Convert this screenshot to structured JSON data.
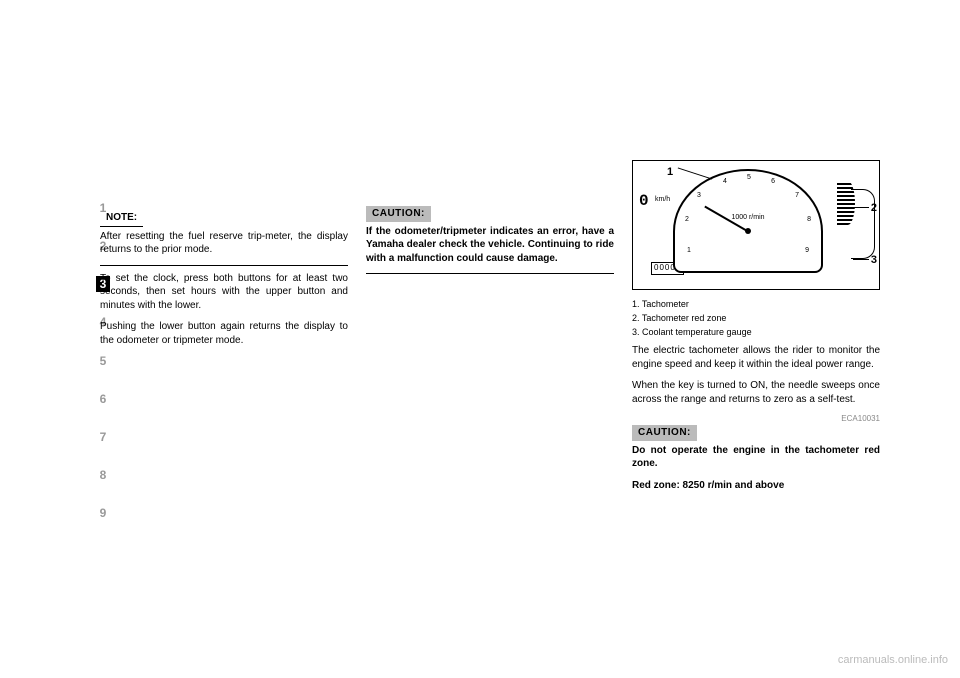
{
  "sidebar": {
    "nums": [
      "1",
      "2",
      "3",
      "4",
      "5",
      "6",
      "7",
      "8",
      "9"
    ],
    "active_index": 2
  },
  "col1": {
    "note_label": "NOTE:",
    "note_text": "After resetting the fuel reserve trip-meter, the display returns to the prior mode.",
    "para2": "To set the clock, press both buttons for at least two seconds, then set hours with the upper button and minutes with the lower.",
    "para3": "Pushing the lower button again returns the display to the odometer or tripmeter mode."
  },
  "col2": {
    "caution_label": "CAUTION:",
    "caution_text": "If the odometer/tripmeter indicates an error, have a Yamaha dealer check the vehicle. Continuing to ride with a malfunction could cause damage."
  },
  "col3": {
    "figure": {
      "dial_unit": "1000 r/min",
      "callout1": "1",
      "callout2": "2",
      "callout3": "3",
      "km_label": "km/h",
      "odometer": "00000",
      "speed": "0",
      "ticks": [
        "1",
        "2",
        "3",
        "4",
        "5",
        "6",
        "7",
        "8",
        "9"
      ]
    },
    "legend": {
      "i1": "1. Tachometer",
      "i2": "2. Tachometer red zone",
      "i3": "3. Coolant temperature gauge"
    },
    "para1": "The electric tachometer allows the rider to monitor the engine speed and keep it within the ideal power range.",
    "para2": "When the key is turned to ON, the needle sweeps once across the range and returns to zero as a self-test.",
    "caution_label": "CAUTION:",
    "ecode": "ECA10031",
    "caution_text": "Do not operate the engine in the tachometer red zone.",
    "caution_text2": "Red zone: 8250 r/min and above"
  },
  "watermark": "carmanuals.online.info"
}
